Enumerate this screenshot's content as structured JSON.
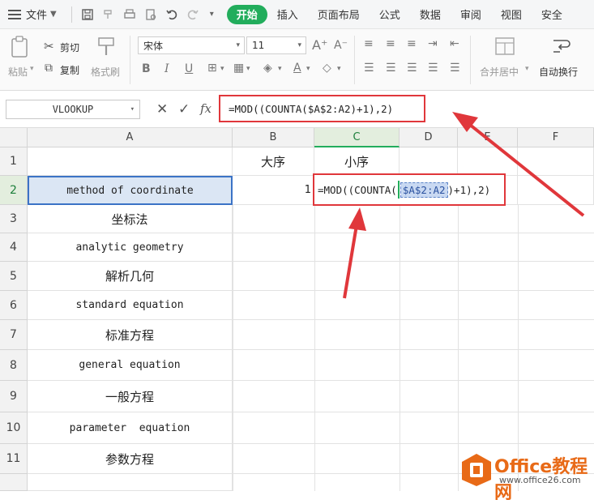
{
  "menubar": {
    "file_label": "文件",
    "tabs": [
      "开始",
      "插入",
      "页面布局",
      "公式",
      "数据",
      "审阅",
      "视图",
      "安全"
    ],
    "active_tab": "开始"
  },
  "ribbon": {
    "paste_label": "粘贴",
    "cut_label": "剪切",
    "copy_label": "复制",
    "format_painter_label": "格式刷",
    "font_name": "宋体",
    "font_size": "11",
    "merge_label": "合并居中",
    "wrap_label": "自动换行"
  },
  "formula_bar": {
    "name_box": "VLOOKUP",
    "fx_label": "fx",
    "formula": "=MOD((COUNTA($A$2:A2)+1),2)"
  },
  "columns": [
    "A",
    "B",
    "C",
    "D",
    "E",
    "F"
  ],
  "rows": [
    "1",
    "2",
    "3",
    "4",
    "5",
    "6",
    "7",
    "8",
    "9",
    "10",
    "11"
  ],
  "cells": {
    "B1": "大序",
    "C1": "小序",
    "A2": "method of coordinate",
    "B2": "1",
    "A3": "坐标法",
    "A4": "analytic geometry",
    "A5": "解析几何",
    "A6": "standard equation",
    "A7": "标准方程",
    "A8": "general equation",
    "A9": "一般方程",
    "A10": "parameter  equation",
    "A11": "参数方程"
  },
  "edit_box": {
    "prefix": "=MOD((COUNTA(",
    "ref": "$A$2:A2",
    "suffix": ")+1),2)"
  },
  "watermark": {
    "brand": "Office教程网",
    "url": "www.office26.com"
  },
  "colors": {
    "accent_green": "#22ad5c",
    "highlight_red": "#e0373b",
    "selection_blue": "#3b73c6",
    "watermark_orange": "#e86a17"
  }
}
